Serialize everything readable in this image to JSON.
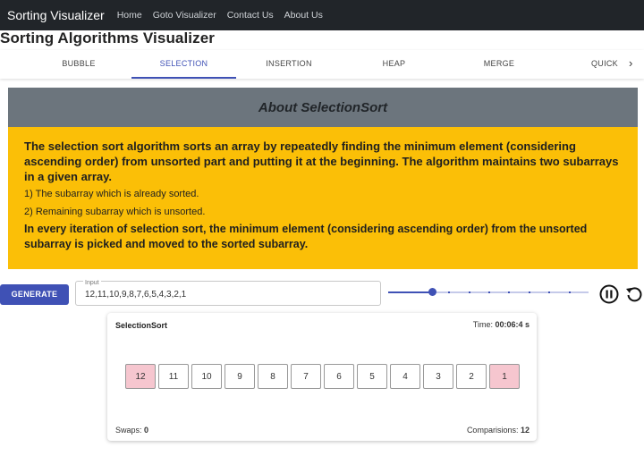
{
  "navbar": {
    "brand": "Sorting Visualizer",
    "links": [
      "Home",
      "Goto Visualizer",
      "Contact Us",
      "About Us"
    ]
  },
  "page_title": "Sorting Algorithms Visualizer",
  "tabs": [
    {
      "label": "BUBBLE",
      "active": false
    },
    {
      "label": "SELECTION",
      "active": true
    },
    {
      "label": "INSERTION",
      "active": false
    },
    {
      "label": "HEAP",
      "active": false
    },
    {
      "label": "MERGE",
      "active": false
    },
    {
      "label": "QUICK",
      "active": false
    }
  ],
  "tab_scroll_icon": "chevron-right",
  "about": {
    "title": "About SelectionSort",
    "p1": "The selection sort algorithm sorts an array by repeatedly finding the minimum element (considering ascending order) from unsorted part and putting it at the beginning. The algorithm maintains two subarrays in a given array.",
    "li1": "1) The subarray which is already sorted.",
    "li2": "2) Remaining subarray which is unsorted.",
    "p2": "In every iteration of selection sort, the minimum element (considering ascending order) from the unsorted subarray is picked and moved to the sorted subarray."
  },
  "controls": {
    "generate_label": "GENERATE",
    "input_label": "Input",
    "input_value": "12,11,10,9,8,7,6,5,4,3,2,1",
    "speed_fraction": 0.22,
    "speed_steps": 10,
    "pause_icon": "pause-circle",
    "reset_icon": "reset"
  },
  "visualizer": {
    "algorithm": "SelectionSort",
    "time_label": "Time:",
    "time_value": "00:06:4 s",
    "array": [
      12,
      11,
      10,
      9,
      8,
      7,
      6,
      5,
      4,
      3,
      2,
      1
    ],
    "highlighted_indices": [
      0,
      11
    ],
    "highlight_color": "#f6c6cf",
    "swaps_label": "Swaps:",
    "swaps_value": "0",
    "comparisons_label": "Comparisions:",
    "comparisons_value": "12"
  },
  "colors": {
    "navbar": "#212529",
    "accent": "#3f51b5",
    "about_header": "#6c757d",
    "about_body": "#fbbf07"
  }
}
